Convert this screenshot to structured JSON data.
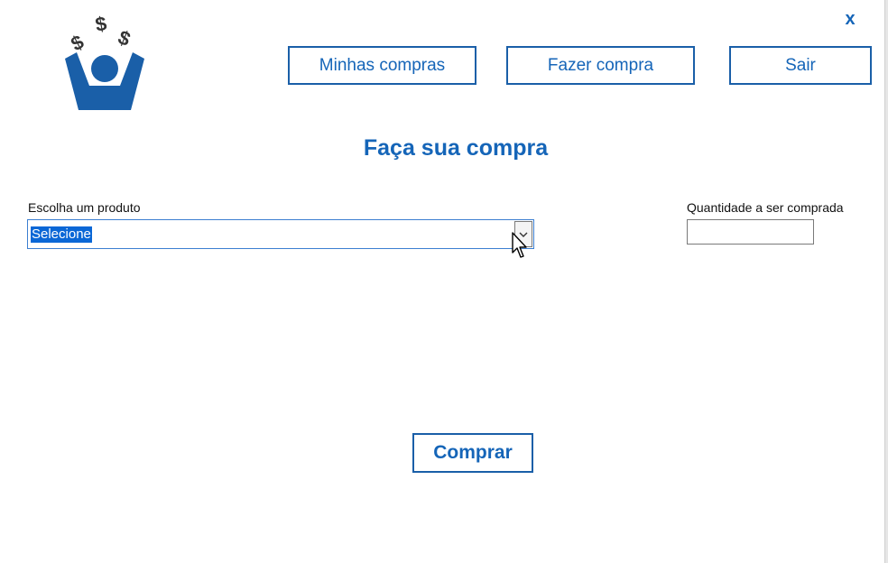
{
  "window": {
    "close_label": "x"
  },
  "logo": {
    "icon": "money-person-icon",
    "symbols": [
      "$",
      "$",
      "$"
    ],
    "color": "#1a5fa8"
  },
  "nav": {
    "minhas_compras": "Minhas compras",
    "fazer_compra": "Fazer compra",
    "sair": "Sair"
  },
  "main": {
    "title": "Faça sua compra",
    "produto_label": "Escolha um produto",
    "produto_selected": "Selecione",
    "quantidade_label": "Quantidade a ser comprada",
    "quantidade_value": "",
    "comprar_label": "Comprar"
  },
  "colors": {
    "accent": "#1565b8",
    "border": "#1a5fa8",
    "selection": "#0a67d6"
  }
}
